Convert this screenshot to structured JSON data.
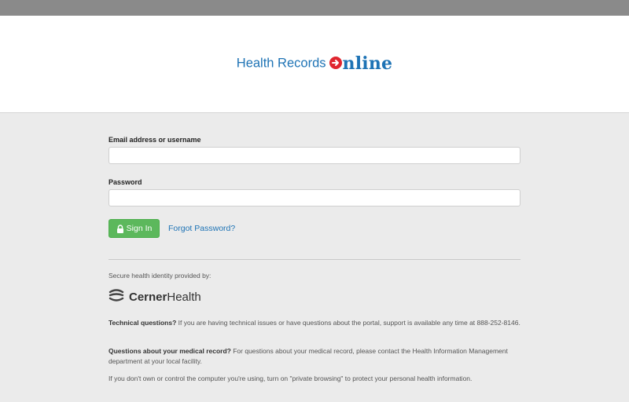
{
  "header": {
    "logo_health": "Health Records",
    "logo_online": "nline"
  },
  "login": {
    "email_label": "Email address or username",
    "email_value": "",
    "password_label": "Password",
    "password_value": "",
    "signin_label": "Sign In",
    "forgot_label": "Forgot Password?"
  },
  "footer": {
    "identity_text": "Secure health identity provided by:",
    "cerner_bold": "Cerner",
    "cerner_regular": "Health",
    "tech_title": "Technical questions?",
    "tech_text": " If you are having technical issues or have questions about the portal, support is available any time at 888-252-8146.",
    "record_title": "Questions about your medical record?",
    "record_text": " For questions about your medical record, please contact the Health Information Management department at your local facility.",
    "privacy_text": "If you don't own or control the computer you're using, turn on \"private browsing\" to protect your personal health information."
  },
  "colors": {
    "brand_blue": "#1e73b5",
    "brand_red": "#e0262f",
    "signin_green": "#5cb85c"
  }
}
